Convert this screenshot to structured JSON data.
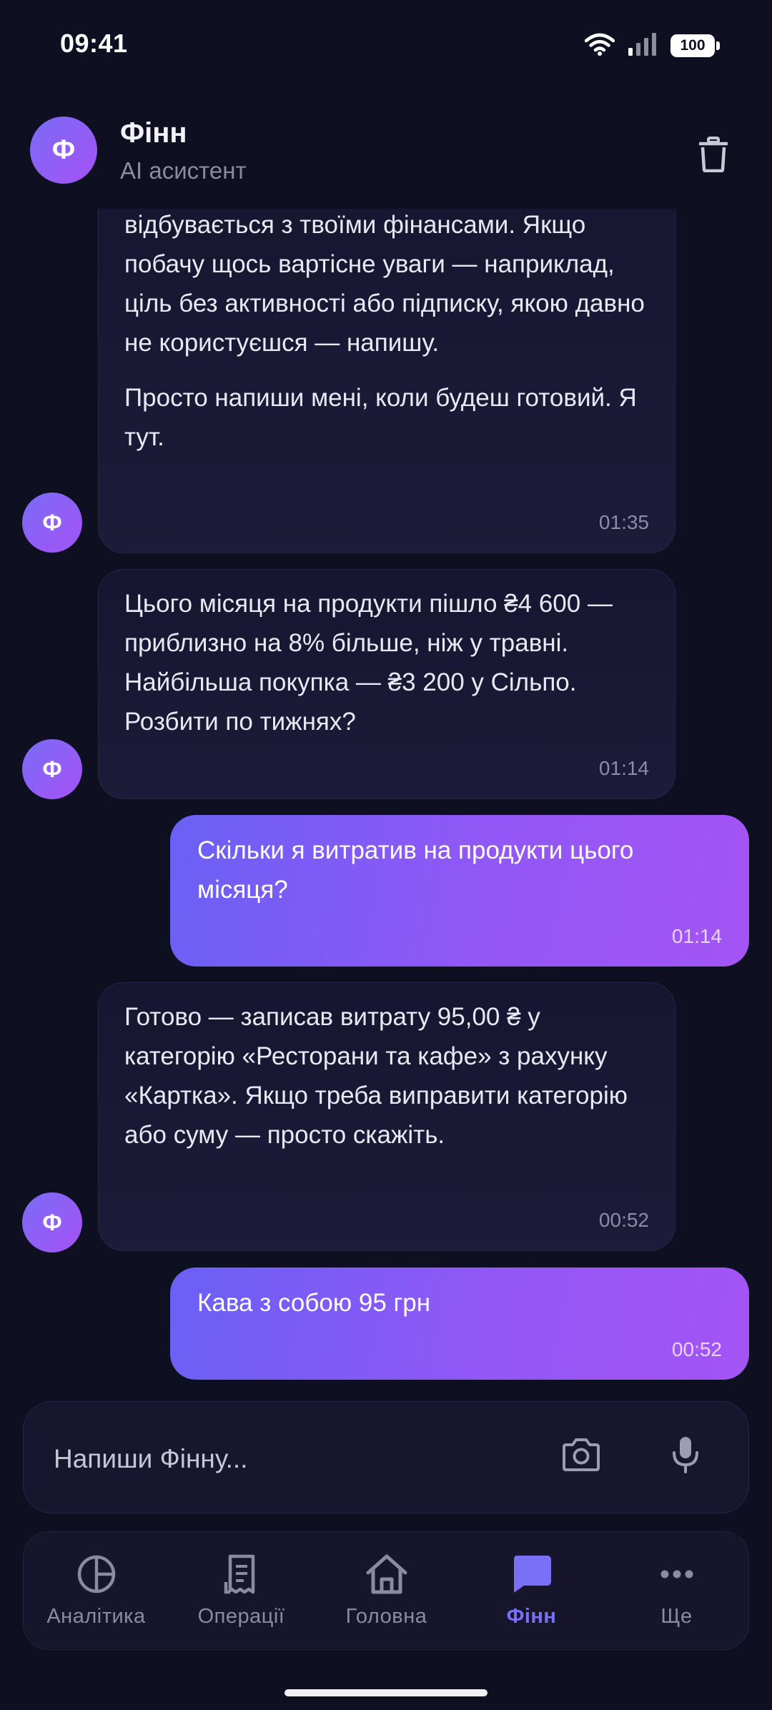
{
  "status_bar": {
    "time": "09:41",
    "battery": "100",
    "icons": [
      "wifi-icon",
      "signal-icon",
      "battery-icon"
    ]
  },
  "header": {
    "avatar_letter": "Ф",
    "title": "Фінн",
    "subtitle": "AI асистент",
    "action_icon": "trash-icon"
  },
  "messages": [
    {
      "sender": "bot",
      "paragraphs": [
        "відбувається з твоїми фінансами. Якщо побачу щось вартісне уваги — наприклад, ціль без активності або підписку, якою давно не користуєшся — напишу.",
        "Просто напиши мені, коли будеш готовий. Я тут."
      ],
      "time": "01:35"
    },
    {
      "sender": "bot",
      "paragraphs": [
        "Цього місяця на продукти пішло ₴4 600 — приблизно на 8% більше, ніж у травні. Найбільша покупка — ₴3 200 у Сільпо. Розбити по тижнях?"
      ],
      "time": "01:14"
    },
    {
      "sender": "user",
      "paragraphs": [
        "Скільки я витратив на продукти цього місяця?"
      ],
      "time": "01:14"
    },
    {
      "sender": "bot",
      "paragraphs": [
        "Готово — записав витрату 95,00 ₴ у категорію «Ресторани та кафе» з рахунку «Картка». Якщо треба виправити категорію або суму — просто скажіть."
      ],
      "time": "00:52"
    },
    {
      "sender": "user",
      "paragraphs": [
        "Кава з собою 95 грн"
      ],
      "time": "00:52"
    }
  ],
  "bot_avatar_letter": "Ф",
  "composer": {
    "placeholder": "Напиши Фінну...",
    "icons": [
      "camera-icon",
      "microphone-icon"
    ]
  },
  "nav": {
    "items": [
      {
        "label": "Аналітика",
        "icon": "pie-chart-icon"
      },
      {
        "label": "Операції",
        "icon": "receipt-icon"
      },
      {
        "label": "Головна",
        "icon": "home-icon"
      },
      {
        "label": "Фінн",
        "icon": "chat-icon",
        "active": true
      },
      {
        "label": "Ще",
        "icon": "more-icon"
      }
    ]
  },
  "colors": {
    "background": "#0f0f22",
    "accent": "#7a6ff7",
    "accent_end": "#a454f4",
    "bot_bubble": "#1a1935",
    "muted_text": "#8a8aa0"
  }
}
